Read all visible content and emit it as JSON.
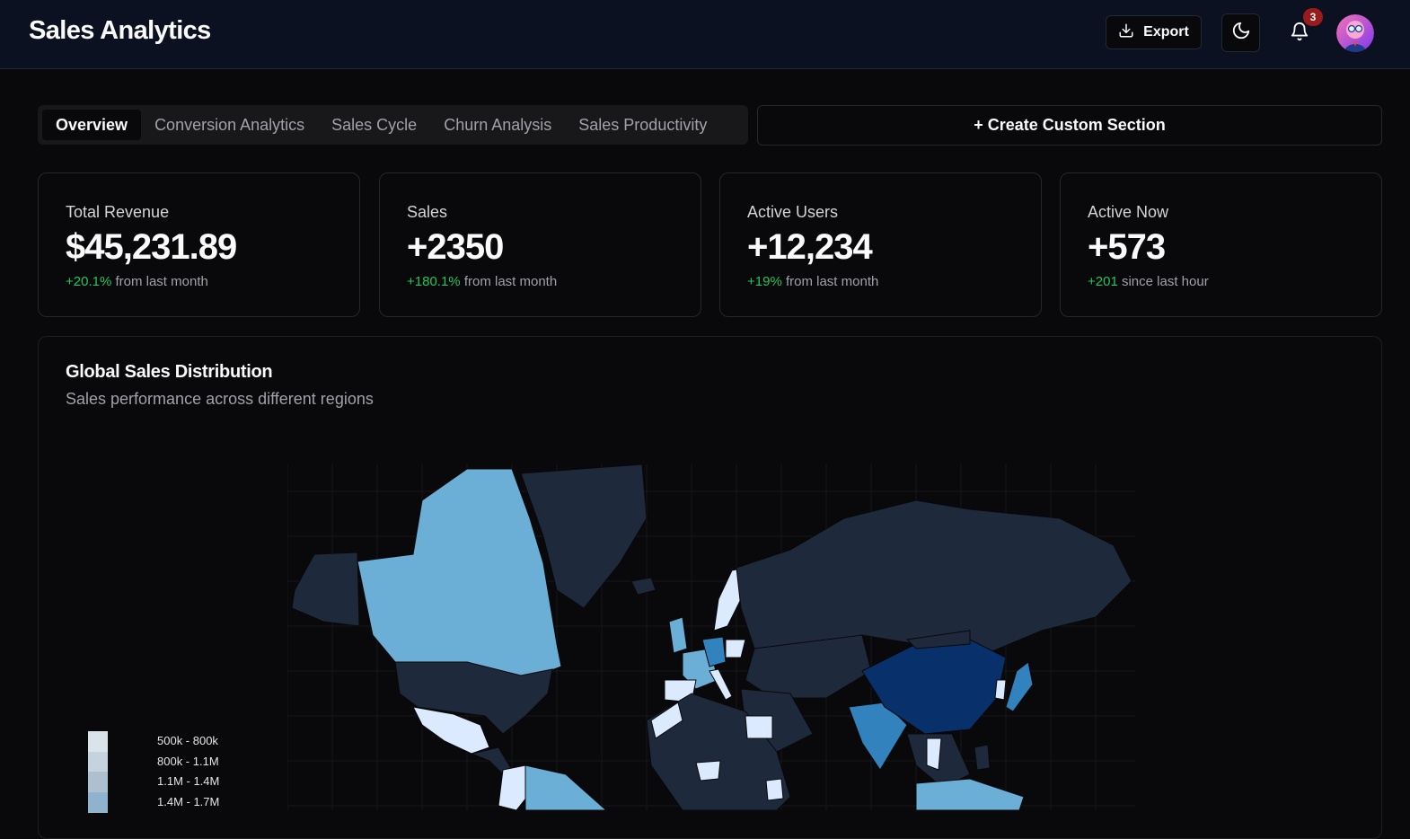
{
  "header": {
    "title": "Sales Analytics",
    "export_label": "Export",
    "notifications_count": "3"
  },
  "tabs": [
    {
      "label": "Overview",
      "active": true
    },
    {
      "label": "Conversion Analytics",
      "active": false
    },
    {
      "label": "Sales Cycle",
      "active": false
    },
    {
      "label": "Churn Analysis",
      "active": false
    },
    {
      "label": "Sales Productivity",
      "active": false
    }
  ],
  "create_section_label": "+ Create Custom Section",
  "kpis": [
    {
      "label": "Total Revenue",
      "value": "$45,231.89",
      "change": "+20.1%",
      "suffix": "from last month"
    },
    {
      "label": "Sales",
      "value": "+2350",
      "change": "+180.1%",
      "suffix": "from last month"
    },
    {
      "label": "Active Users",
      "value": "+12,234",
      "change": "+19%",
      "suffix": "from last month"
    },
    {
      "label": "Active Now",
      "value": "+573",
      "change": "+201",
      "suffix": "since last hour"
    }
  ],
  "map_panel": {
    "title": "Global Sales Distribution",
    "description": "Sales performance across different regions",
    "legend": [
      {
        "label": "500k - 800k",
        "color": "#dbe3ea"
      },
      {
        "label": "800k - 1.1M",
        "color": "#c5d3df"
      },
      {
        "label": "1.1M - 1.4M",
        "color": "#aebfcf"
      },
      {
        "label": "1.4M - 1.7M",
        "color": "#8fb3cc"
      }
    ]
  },
  "colors": {
    "positive": "#22c55e",
    "map_dark": "#1e293b",
    "map_light": "#dbeafe",
    "map_mid": "#6baed6",
    "map_blue": "#3182bd",
    "map_deep": "#08306b"
  }
}
